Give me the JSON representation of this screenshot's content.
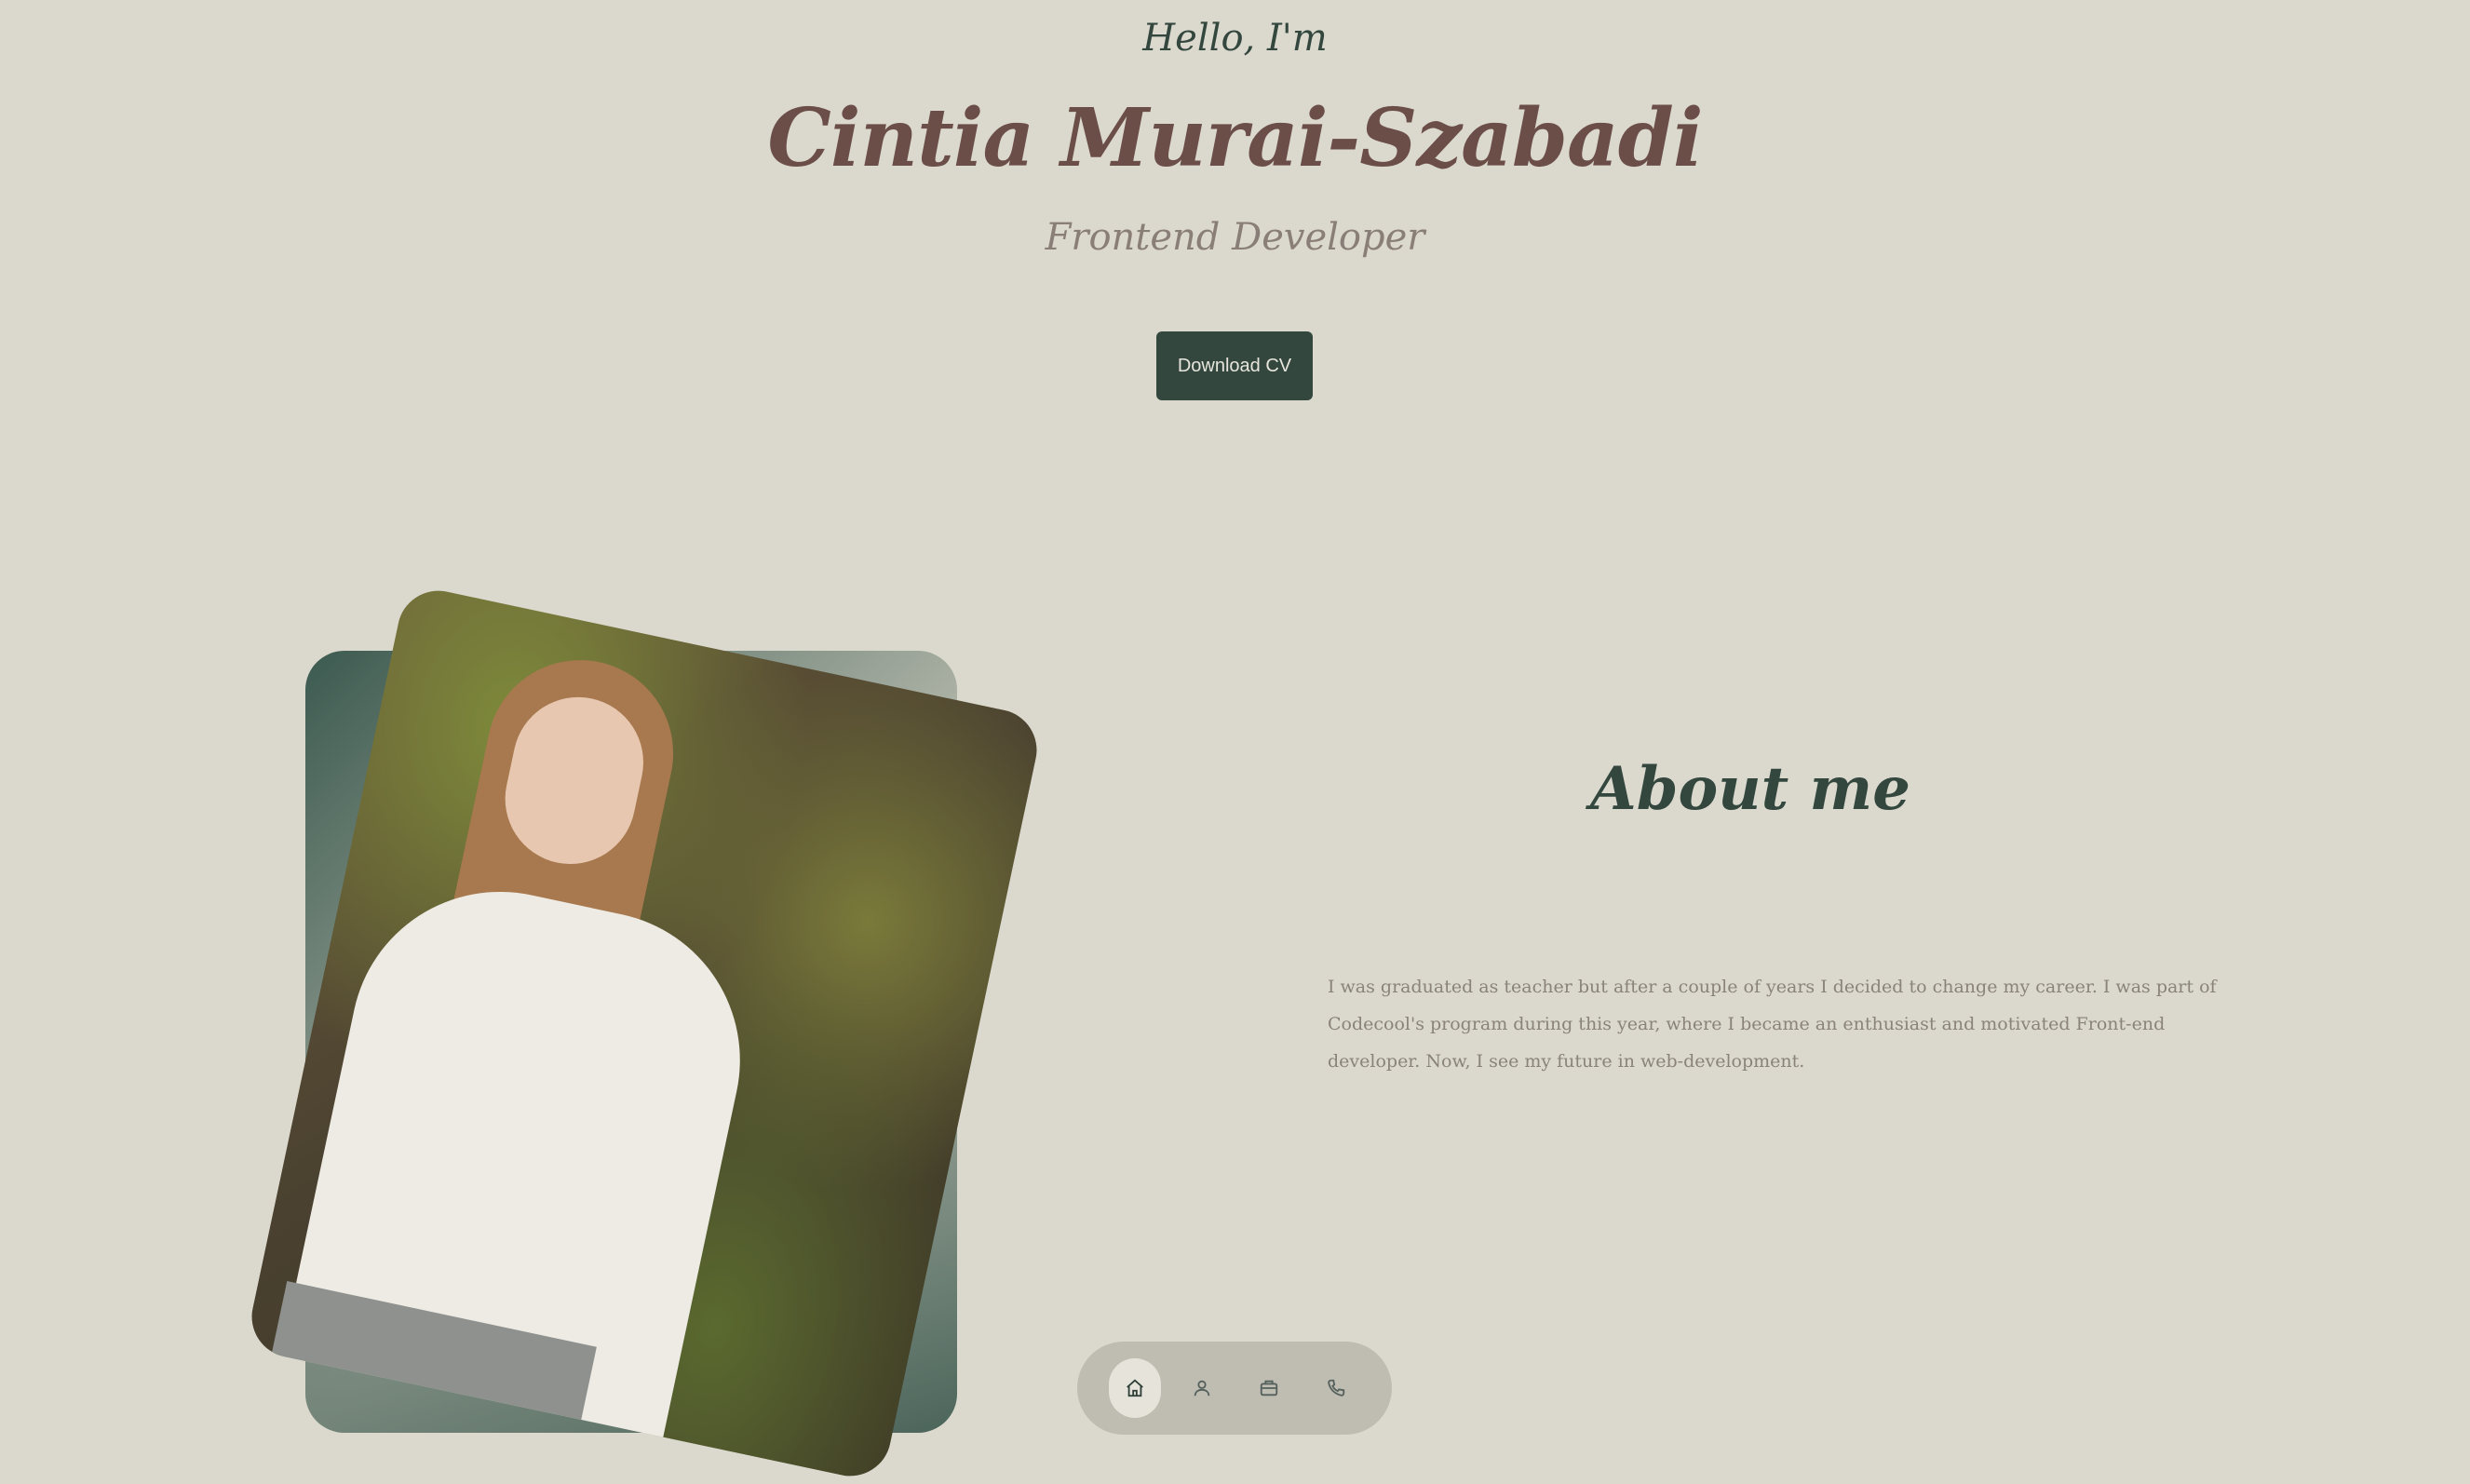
{
  "hero": {
    "greeting": "Hello, I'm",
    "name": "Cintia Murai-Szabadi",
    "role": "Frontend Developer",
    "cv_button": "Download CV"
  },
  "about": {
    "title": "About me",
    "text": "I was graduated as teacher but after a couple of years I decided to change my career. I was part of Codecool's program during this year, where I became an enthusiast and motivated Front-end developer. Now, I see my future in web-development."
  },
  "nav": {
    "items": [
      {
        "icon": "home-icon",
        "active": true
      },
      {
        "icon": "user-icon",
        "active": false
      },
      {
        "icon": "briefcase-icon",
        "active": false
      },
      {
        "icon": "phone-icon",
        "active": false
      }
    ]
  },
  "colors": {
    "background": "#dbd9ce",
    "accent": "#33473f",
    "name": "#6b4e48"
  }
}
